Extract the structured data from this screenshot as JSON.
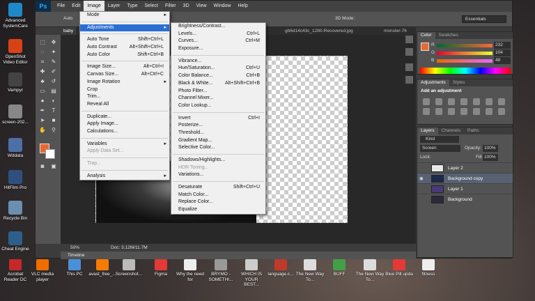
{
  "desktop_icons": [
    {
      "label": "Advanced SystemCare",
      "color": "#1e88c8"
    },
    {
      "label": "OpenShot Video Editor",
      "color": "#d84315"
    },
    {
      "label": "Vampyr",
      "color": "#444444"
    },
    {
      "label": "screen-202...",
      "color": "#888888"
    },
    {
      "label": "Wddata",
      "color": "#4d6fa8"
    },
    {
      "label": "HitFilm Pro",
      "color": "#2f4f7f"
    },
    {
      "label": "Recycle Bin",
      "color": "#6a8fb0"
    },
    {
      "label": "Cheat Engine",
      "color": "#2e5f8a"
    }
  ],
  "taskbar_icons": [
    {
      "label": "Acrobat Reader DC",
      "color": "#c62828"
    },
    {
      "label": "VLC media player",
      "color": "#ef6c00"
    },
    {
      "label": "This PC",
      "color": "#4a90d9"
    },
    {
      "label": "avast_free_...",
      "color": "#f57c00"
    },
    {
      "label": "Screenshot...",
      "color": "#bbbbbb"
    },
    {
      "label": "Figma",
      "color": "#e53935"
    },
    {
      "label": "Why the need for",
      "color": "#eeeeee"
    },
    {
      "label": "BRYMO - SOMETHI...",
      "color": "#999999"
    },
    {
      "label": "WHICH IS YOUR BEST...",
      "color": "#cccccc"
    },
    {
      "label": "language.c...",
      "color": "#c0392b"
    },
    {
      "label": "The New Way To...",
      "color": "#dddddd"
    },
    {
      "label": "BUFF",
      "color": "#43a047"
    },
    {
      "label": "The New Way To...",
      "color": "#dddddd"
    },
    {
      "label": "Blue Pill upda",
      "color": "#e53935"
    },
    {
      "label": "fitness",
      "color": "#eeeeee"
    }
  ],
  "menubar": {
    "logo": "Ps",
    "items": [
      "File",
      "Edit",
      "Image",
      "Layer",
      "Type",
      "Select",
      "Filter",
      "3D",
      "View",
      "Window",
      "Help"
    ],
    "active": "Image"
  },
  "options_bar": {
    "auto_label": "Auto",
    "mode_label": "3D Mode:",
    "workspace": "Essentials"
  },
  "doc_tabs": [
    "baby",
    "gb6d14c43c_1280-Recovered.jpg",
    "monster-76"
  ],
  "image_menu": {
    "items": [
      {
        "label": "Mode",
        "shortcut": "",
        "arrow": true
      },
      {
        "sep": true
      },
      {
        "label": "Adjustments",
        "shortcut": "",
        "arrow": true,
        "highlight": true
      },
      {
        "sep": true
      },
      {
        "label": "Auto Tone",
        "shortcut": "Shift+Ctrl+L"
      },
      {
        "label": "Auto Contrast",
        "shortcut": "Alt+Shift+Ctrl+L"
      },
      {
        "label": "Auto Color",
        "shortcut": "Shift+Ctrl+B"
      },
      {
        "sep": true
      },
      {
        "label": "Image Size...",
        "shortcut": "Alt+Ctrl+I"
      },
      {
        "label": "Canvas Size...",
        "shortcut": "Alt+Ctrl+C"
      },
      {
        "label": "Image Rotation",
        "shortcut": "",
        "arrow": true
      },
      {
        "label": "Crop",
        "shortcut": ""
      },
      {
        "label": "Trim...",
        "shortcut": ""
      },
      {
        "label": "Reveal All",
        "shortcut": ""
      },
      {
        "sep": true
      },
      {
        "label": "Duplicate...",
        "shortcut": ""
      },
      {
        "label": "Apply Image...",
        "shortcut": ""
      },
      {
        "label": "Calculations...",
        "shortcut": ""
      },
      {
        "sep": true
      },
      {
        "label": "Variables",
        "shortcut": "",
        "arrow": true
      },
      {
        "label": "Apply Data Set...",
        "shortcut": "",
        "disabled": true
      },
      {
        "sep": true
      },
      {
        "label": "Trap...",
        "shortcut": "",
        "disabled": true
      },
      {
        "sep": true
      },
      {
        "label": "Analysis",
        "shortcut": "",
        "arrow": true
      }
    ]
  },
  "adjustments_menu": {
    "items": [
      {
        "label": "Brightness/Contrast...",
        "shortcut": ""
      },
      {
        "label": "Levels...",
        "shortcut": "Ctrl+L"
      },
      {
        "label": "Curves...",
        "shortcut": "Ctrl+M"
      },
      {
        "label": "Exposure...",
        "shortcut": ""
      },
      {
        "sep": true
      },
      {
        "label": "Vibrance...",
        "shortcut": ""
      },
      {
        "label": "Hue/Saturation...",
        "shortcut": "Ctrl+U"
      },
      {
        "label": "Color Balance...",
        "shortcut": "Ctrl+B"
      },
      {
        "label": "Black & White...",
        "shortcut": "Alt+Shift+Ctrl+B"
      },
      {
        "label": "Photo Filter...",
        "shortcut": ""
      },
      {
        "label": "Channel Mixer...",
        "shortcut": ""
      },
      {
        "label": "Color Lookup...",
        "shortcut": ""
      },
      {
        "sep": true
      },
      {
        "label": "Invert",
        "shortcut": "Ctrl+I"
      },
      {
        "label": "Posterize...",
        "shortcut": ""
      },
      {
        "label": "Threshold...",
        "shortcut": ""
      },
      {
        "label": "Gradient Map...",
        "shortcut": ""
      },
      {
        "label": "Selective Color...",
        "shortcut": ""
      },
      {
        "sep": true
      },
      {
        "label": "Shadows/Highlights...",
        "shortcut": ""
      },
      {
        "label": "HDR Toning...",
        "shortcut": "",
        "disabled": true
      },
      {
        "label": "Variations...",
        "shortcut": ""
      },
      {
        "sep": true
      },
      {
        "label": "Desaturate",
        "shortcut": "Shift+Ctrl+U"
      },
      {
        "label": "Match Color...",
        "shortcut": ""
      },
      {
        "label": "Replace Color...",
        "shortcut": ""
      },
      {
        "label": "Equalize",
        "shortcut": ""
      }
    ]
  },
  "status": {
    "zoom": "50%",
    "doc_info": "Doc: 3.12M/11.7M"
  },
  "timeline_label": "Timeline",
  "color_panel": {
    "tabs": [
      "Color",
      "Swatches"
    ],
    "r": "232",
    "g": "104",
    "b": "48",
    "r_label": "R",
    "g_label": "G",
    "b_label": "B",
    "fg_color": "#e86830"
  },
  "adjustments_panel": {
    "tabs": [
      "Adjustments",
      "Styles"
    ],
    "heading": "Add an adjustment"
  },
  "layers_panel": {
    "tabs": [
      "Layers",
      "Channels",
      "Paths"
    ],
    "kind": "Kind",
    "blend_mode": "Screen",
    "opacity_label": "Opacity:",
    "opacity": "100%",
    "lock_label": "Lock:",
    "fill_label": "Fill:",
    "fill": "100%",
    "layers": [
      {
        "name": "Layer 2",
        "visible": false,
        "selected": false,
        "thumb": "#e8e8e8"
      },
      {
        "name": "Background copy",
        "visible": true,
        "selected": true,
        "thumb": "#1e2a4a"
      },
      {
        "name": "Layer 1",
        "visible": false,
        "selected": false,
        "thumb": "#4a3a7a"
      },
      {
        "name": "Background",
        "visible": false,
        "selected": false,
        "thumb": "#2a2a3a"
      }
    ]
  }
}
